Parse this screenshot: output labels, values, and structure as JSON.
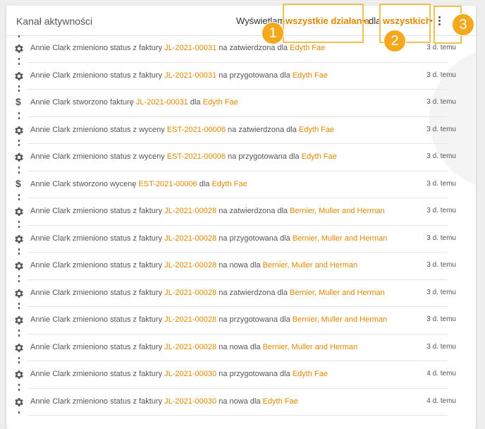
{
  "header": {
    "title": "Kanał aktywności",
    "show_label": "Wyświetlam",
    "filter_action": "wszystkie działania",
    "for_label": "dla",
    "filter_target": "wszystkich"
  },
  "badges": [
    "1",
    "2",
    "3"
  ],
  "colors": {
    "link": "#e08800",
    "badge": "#f4a81c",
    "highlight": "#f0c050"
  },
  "feed": [
    {
      "icon": "gear-icon",
      "pre": "Annie Clark zmieniono status z faktury ",
      "doc": "JL-2021-00031",
      "mid": " na zatwierdzona dla ",
      "client": "Edyth Fae",
      "time": "3 d. temu"
    },
    {
      "icon": "gear-icon",
      "pre": "Annie Clark zmieniono status z faktury ",
      "doc": "JL-2021-00031",
      "mid": " na przygotowana dla ",
      "client": "Edyth Fae",
      "time": "3 d. temu"
    },
    {
      "icon": "dollar-icon",
      "pre": "Annie Clark stworzono fakturę ",
      "doc": "JL-2021-00031",
      "mid": " dla ",
      "client": "Edyth Fae",
      "time": "3 d. temu"
    },
    {
      "icon": "gear-icon",
      "pre": "Annie Clark zmieniono status z wyceny ",
      "doc": "EST-2021-00006",
      "mid": " na zatwierdzona dla ",
      "client": "Edyth Fae",
      "time": "3 d. temu"
    },
    {
      "icon": "gear-icon",
      "pre": "Annie Clark zmieniono status z wyceny ",
      "doc": "EST-2021-00006",
      "mid": " na przygotowana dla ",
      "client": "Edyth Fae",
      "time": "3 d. temu"
    },
    {
      "icon": "dollar-icon",
      "pre": "Annie Clark stworzono wycenę ",
      "doc": "EST-2021-00006",
      "mid": " dla ",
      "client": "Edyth Fae",
      "time": "3 d. temu"
    },
    {
      "icon": "gear-icon",
      "pre": "Annie Clark zmieniono status z faktury ",
      "doc": "JL-2021-00028",
      "mid": " na zatwierdzona dla ",
      "client": "Bernier, Muller and Herman",
      "time": "3 d. temu"
    },
    {
      "icon": "gear-icon",
      "pre": "Annie Clark zmieniono status z faktury ",
      "doc": "JL-2021-00028",
      "mid": " na przygotowana dla ",
      "client": "Bernier, Muller and Herman",
      "time": "3 d. temu"
    },
    {
      "icon": "gear-icon",
      "pre": "Annie Clark zmieniono status z faktury ",
      "doc": "JL-2021-00028",
      "mid": " na nowa dla ",
      "client": "Bernier, Muller and Herman",
      "time": "3 d. temu"
    },
    {
      "icon": "gear-icon",
      "pre": "Annie Clark zmieniono status z faktury ",
      "doc": "JL-2021-00028",
      "mid": " na zatwierdzona dla ",
      "client": "Bernier, Muller and Herman",
      "time": "3 d. temu"
    },
    {
      "icon": "gear-icon",
      "pre": "Annie Clark zmieniono status z faktury ",
      "doc": "JL-2021-00028",
      "mid": " na przygotowana dla ",
      "client": "Bernier, Muller and Herman",
      "time": "3 d. temu"
    },
    {
      "icon": "gear-icon",
      "pre": "Annie Clark zmieniono status z faktury ",
      "doc": "JL-2021-00028",
      "mid": " na nowa dla ",
      "client": "Bernier, Muller and Herman",
      "time": "3 d. temu"
    },
    {
      "icon": "gear-icon",
      "pre": "Annie Clark zmieniono status z faktury ",
      "doc": "JL-2021-00030",
      "mid": " na przygotowana dla ",
      "client": "Edyth Fae",
      "time": "4 d. temu"
    },
    {
      "icon": "gear-icon",
      "pre": "Annie Clark zmieniono status z faktury ",
      "doc": "JL-2021-00030",
      "mid": " na nowa dla ",
      "client": "Edyth Fae",
      "time": "4 d. temu"
    }
  ]
}
